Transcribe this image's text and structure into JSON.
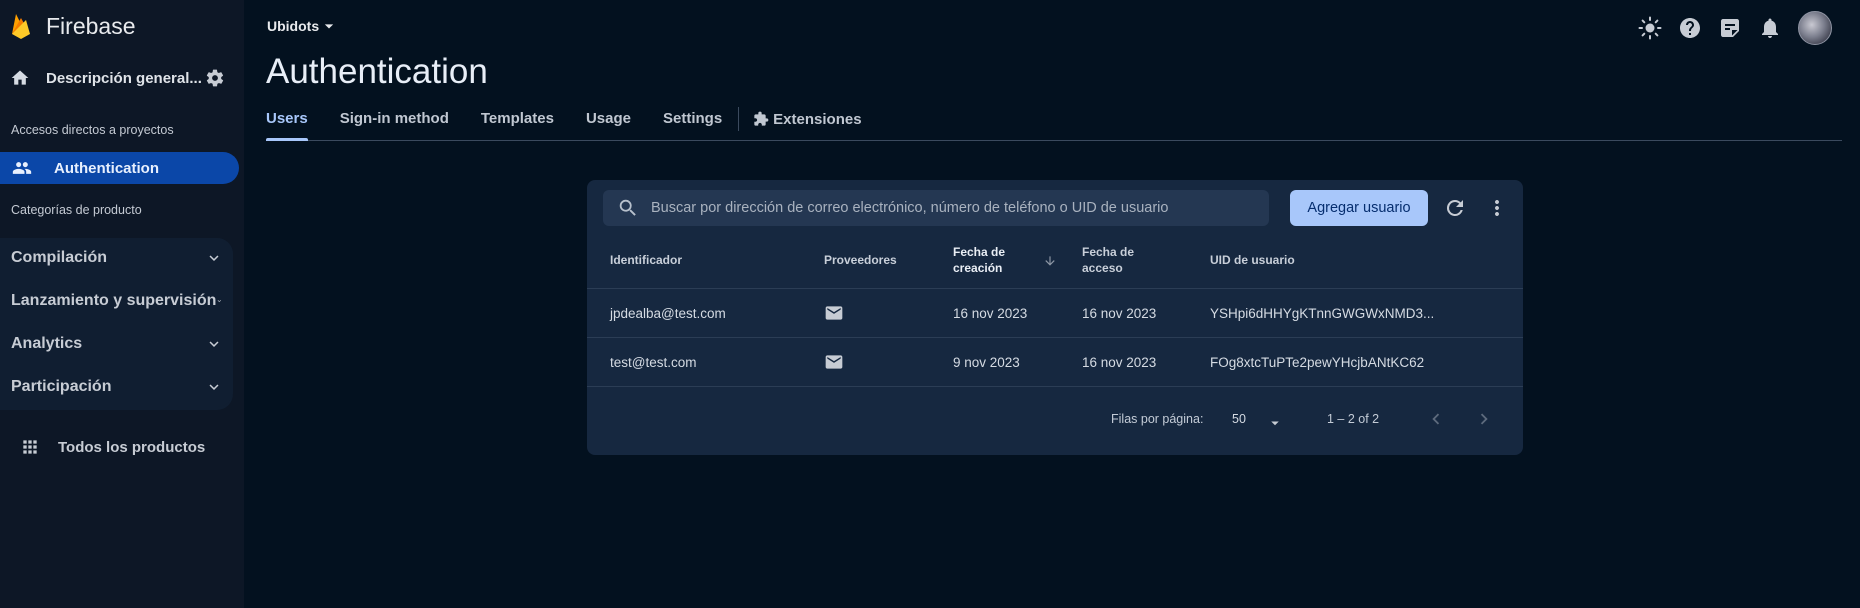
{
  "app": {
    "brand": "Firebase"
  },
  "project": {
    "name": "Ubidots"
  },
  "sidebar": {
    "overview_label": "Descripción general...",
    "shortcuts_title": "Accesos directos a proyectos",
    "active_item": "Authentication",
    "categories_title": "Categorías de producto",
    "categories": [
      {
        "label": "Compilación"
      },
      {
        "label": "Lanzamiento y supervisión"
      },
      {
        "label": "Analytics"
      },
      {
        "label": "Participación"
      }
    ],
    "all_products": "Todos los productos"
  },
  "page": {
    "title": "Authentication",
    "tabs": [
      {
        "label": "Users"
      },
      {
        "label": "Sign-in method"
      },
      {
        "label": "Templates"
      },
      {
        "label": "Usage"
      },
      {
        "label": "Settings"
      },
      {
        "label": "Extensiones"
      }
    ]
  },
  "users": {
    "search_placeholder": "Buscar por dirección de correo electrónico, número de teléfono o UID de usuario",
    "add_button": "Agregar usuario",
    "columns": {
      "identifier": "Identificador",
      "providers": "Proveedores",
      "created_1": "Fecha de",
      "created_2": "creación",
      "signed_in_1": "Fecha de",
      "signed_in_2": "acceso",
      "uid": "UID de usuario"
    },
    "rows": [
      {
        "identifier": "jpdealba@test.com",
        "provider": "email-icon",
        "created": "16 nov 2023",
        "signed_in": "16 nov 2023",
        "uid": "YSHpi6dHHYgKTnnGWGWxNMD3..."
      },
      {
        "identifier": "test@test.com",
        "provider": "email-icon",
        "created": "9 nov 2023",
        "signed_in": "16 nov 2023",
        "uid": "FOg8xtcTuPTe2pewYHcjbANtKC62"
      }
    ],
    "footer": {
      "rows_per_page_label": "Filas por página:",
      "rows_per_page": "50",
      "range": "1 – 2 of 2"
    }
  },
  "colors": {
    "accent": "#a8c7fa",
    "active_nav": "#0b47a8",
    "card": "#162840",
    "background": "#03111f"
  }
}
